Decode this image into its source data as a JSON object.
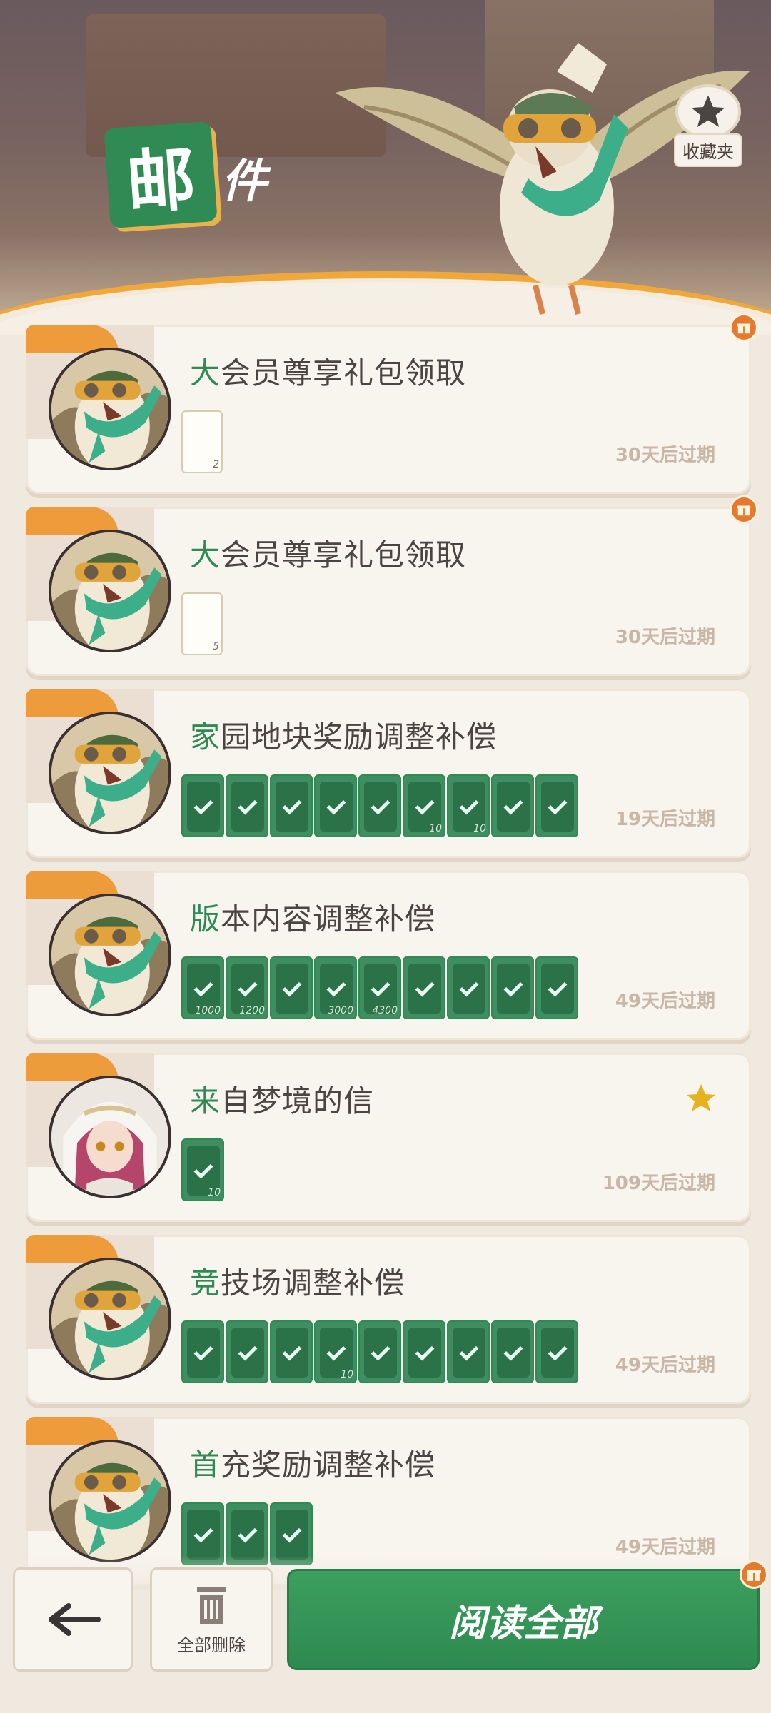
{
  "header": {
    "title_main": "邮",
    "title_rest": "件",
    "favorites_label": "收藏夹"
  },
  "mails": [
    {
      "first": "大",
      "rest": "会员尊享礼包领取",
      "expire": "30天后过期",
      "avatar": "bird",
      "badge": "gift",
      "items": [
        {
          "type": "paper",
          "qty": "2",
          "claimed": false
        }
      ]
    },
    {
      "first": "大",
      "rest": "会员尊享礼包领取",
      "expire": "30天后过期",
      "avatar": "bird",
      "badge": "gift",
      "items": [
        {
          "type": "paper",
          "qty": "5",
          "claimed": false
        }
      ]
    },
    {
      "first": "家",
      "rest": "园地块奖励调整补偿",
      "expire": "19天后过期",
      "avatar": "bird",
      "badge": "none",
      "items": [
        {
          "qty": "",
          "claimed": true
        },
        {
          "qty": "",
          "claimed": true
        },
        {
          "qty": "",
          "claimed": true
        },
        {
          "qty": "",
          "claimed": true
        },
        {
          "qty": "",
          "claimed": true
        },
        {
          "qty": "10",
          "claimed": true
        },
        {
          "qty": "10",
          "claimed": true
        },
        {
          "qty": "",
          "claimed": true
        },
        {
          "qty": "",
          "claimed": true
        }
      ]
    },
    {
      "first": "版",
      "rest": "本内容调整补偿",
      "expire": "49天后过期",
      "avatar": "bird",
      "badge": "none",
      "items": [
        {
          "qty": "1000",
          "claimed": true
        },
        {
          "qty": "1200",
          "claimed": true
        },
        {
          "qty": "",
          "claimed": true
        },
        {
          "qty": "3000",
          "claimed": true
        },
        {
          "qty": "4300",
          "claimed": true
        },
        {
          "qty": "",
          "claimed": true
        },
        {
          "qty": "",
          "claimed": true
        },
        {
          "qty": "",
          "claimed": true
        },
        {
          "qty": "",
          "claimed": true
        }
      ]
    },
    {
      "first": "来",
      "rest": "自梦境的信",
      "expire": "109天后过期",
      "avatar": "girl",
      "badge": "star",
      "items": [
        {
          "qty": "10",
          "claimed": true
        }
      ]
    },
    {
      "first": "竞",
      "rest": "技场调整补偿",
      "expire": "49天后过期",
      "avatar": "bird",
      "badge": "none",
      "items": [
        {
          "qty": "",
          "claimed": true
        },
        {
          "qty": "",
          "claimed": true
        },
        {
          "qty": "",
          "claimed": true
        },
        {
          "qty": "10",
          "claimed": true
        },
        {
          "qty": "",
          "claimed": true
        },
        {
          "qty": "",
          "claimed": true
        },
        {
          "qty": "",
          "claimed": true
        },
        {
          "qty": "",
          "claimed": true
        },
        {
          "qty": "",
          "claimed": true
        }
      ]
    },
    {
      "first": "首",
      "rest": "充奖励调整补偿",
      "expire": "49天后过期",
      "avatar": "bird",
      "badge": "none",
      "items": [
        {
          "qty": "",
          "claimed": true
        },
        {
          "qty": "",
          "claimed": true
        },
        {
          "qty": "",
          "claimed": true
        }
      ]
    }
  ],
  "bottom": {
    "delete_all_label": "全部删除",
    "read_all_label": "阅读全部"
  },
  "colors": {
    "accent_green": "#2f8a54",
    "accent_orange": "#ee9b3c",
    "card_bg": "#f8f4ee"
  }
}
